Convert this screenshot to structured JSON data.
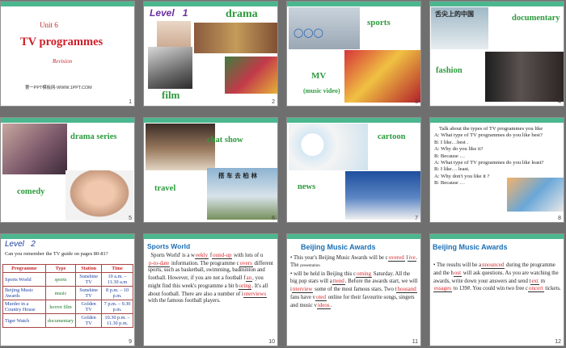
{
  "slides": [
    {
      "num": "1",
      "unit": "Unit 6",
      "title": "TV programmes",
      "subtitle": "Revision",
      "footer": "第一PPT模板网-WWW.1PPT.COM"
    },
    {
      "num": "2",
      "level": "Level",
      "level_no": "1",
      "labels": [
        "drama",
        "film"
      ]
    },
    {
      "num": "3",
      "labels": [
        "sports",
        "MV",
        "(music video)"
      ]
    },
    {
      "num": "4",
      "labels": [
        "documentary",
        "fashion"
      ],
      "poster_text": "舌尖上的中国"
    },
    {
      "num": "5",
      "labels": [
        "drama series",
        "comedy"
      ]
    },
    {
      "num": "6",
      "labels": [
        "chat show",
        "travel"
      ],
      "poster_text": "搭 车 去 柏 林"
    },
    {
      "num": "7",
      "labels": [
        "cartoon",
        "news"
      ]
    },
    {
      "num": "8",
      "lines": [
        "Talk about the types of TV programmes you like",
        "A: What type of TV programmes do you like best?",
        "B: I like…best .",
        "A: Why do you like it?",
        "B: Because …",
        "A: What type of TV programmes do you like least?",
        "B: I like… least.",
        "A: Why don't you like it ?",
        "B: Because …"
      ]
    },
    {
      "num": "9",
      "level": "Level",
      "level_no": "2",
      "question": "Can you remember the TV guide on pages 80-81?",
      "headers": [
        "Programme",
        "Type",
        "Station",
        "Time"
      ],
      "rows": [
        [
          "Sports World",
          "sports",
          "Sunshine TV",
          "10 a.m. – 11.30 a.m"
        ],
        [
          "Beijing Music Awards",
          "music",
          "Sunshine TV",
          "8 p.m. – 10 p.m."
        ],
        [
          "Murder in a Country House",
          "horror film",
          "Golden TV",
          "7 p.m. – 9.30 p.m."
        ],
        [
          "Tiger Watch",
          "documentary",
          "Golden TV",
          "10.30 p.m. – 11.30 p.m."
        ]
      ]
    },
    {
      "num": "10",
      "heading": "Sports World",
      "t": [
        "Sports World' is a w",
        "eekly",
        "f",
        "ound-up",
        "with lots of u",
        "p-to-date",
        "information.  The programme c",
        "overs",
        "different sports, such as basketball, swimming, badminton and football.  However, if you are not a football f",
        "an",
        ", you might find this week's programme a bit b",
        "oring",
        ". It's all about football.  There are also a number of i",
        "nterviews",
        "with the famous football players."
      ]
    },
    {
      "num": "11",
      "heading": "Beijing Music Awards",
      "t": [
        "This year's Beijing Music Awards will be c",
        "overed",
        "l",
        "ive",
        ".  The",
        "presentation",
        "will be held in Beijing this c",
        "oming",
        "Saturday.  All the big pop stars will a",
        "ttend",
        ".  Before the awards start, we will i",
        "nterview",
        "some of the most famous stars. Two t",
        "housand",
        "fans have v",
        "oted",
        "online for their favourite songs, singers and music v",
        "ideos",
        "."
      ]
    },
    {
      "num": "12",
      "heading": "Beijing Music Awards",
      "t": [
        "The results will be a",
        "nnounced",
        "during the programme and the h",
        "ost",
        "will ask questions. As you are watching the awards, write down your answers and send t",
        "ext",
        "m",
        "essages",
        "to 139#. You could win two free c",
        "oncert",
        "tickets."
      ]
    }
  ]
}
